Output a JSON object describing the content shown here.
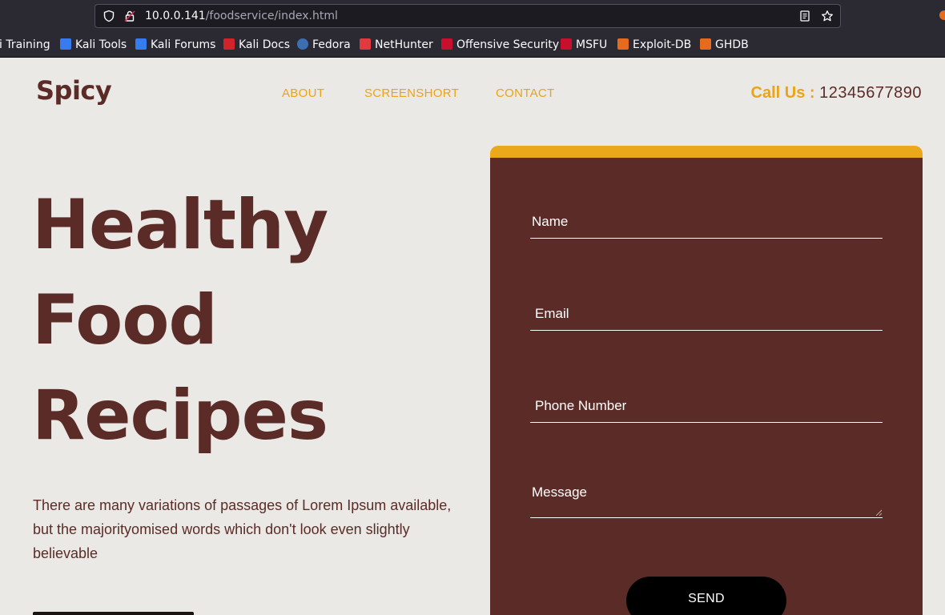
{
  "browser": {
    "url_host": "10.0.0.141",
    "url_path": "/foodservice/index.html",
    "bookmarks": [
      {
        "label": "i Training",
        "icon": "kali-icon",
        "color": "#2b2a33"
      },
      {
        "label": "Kali Tools",
        "icon": "kali-tools-icon",
        "color": "#367bf0"
      },
      {
        "label": "Kali Forums",
        "icon": "kali-forums-icon",
        "color": "#367bf0"
      },
      {
        "label": "Kali Docs",
        "icon": "kali-docs-icon",
        "color": "#d2232a"
      },
      {
        "label": "Fedora",
        "icon": "fedora-icon",
        "color": "#3c6eb4"
      },
      {
        "label": "NetHunter",
        "icon": "nethunter-icon",
        "color": "#e03a3e"
      },
      {
        "label": "Offensive Security",
        "icon": "offsec-icon",
        "color": "#c8102e"
      },
      {
        "label": "MSFU",
        "icon": "msfu-icon",
        "color": "#c8102e"
      },
      {
        "label": "Exploit-DB",
        "icon": "exploit-db-icon",
        "color": "#e66b1e"
      },
      {
        "label": "GHDB",
        "icon": "ghdb-icon",
        "color": "#e66b1e"
      }
    ]
  },
  "site": {
    "logo": "Spicy",
    "nav": [
      "ABOUT",
      "SCREENSHORT",
      "CONTACT"
    ],
    "call_label": "Call Us :",
    "call_number": "12345677890"
  },
  "hero": {
    "title_lines": [
      "Healthy",
      "Food",
      "Recipes"
    ],
    "text": "There are many variations of passages of Lorem Ipsum available, but the majorityomised words which don't look even slightly believable"
  },
  "form": {
    "name_placeholder": "Name",
    "email_placeholder": "Email",
    "phone_placeholder": "Phone Number",
    "message_placeholder": "Message",
    "send_label": "SEND"
  },
  "colors": {
    "brand_brown": "#5b2c27",
    "accent_gold": "#e9a41a",
    "page_bg": "#ebe9e5"
  }
}
